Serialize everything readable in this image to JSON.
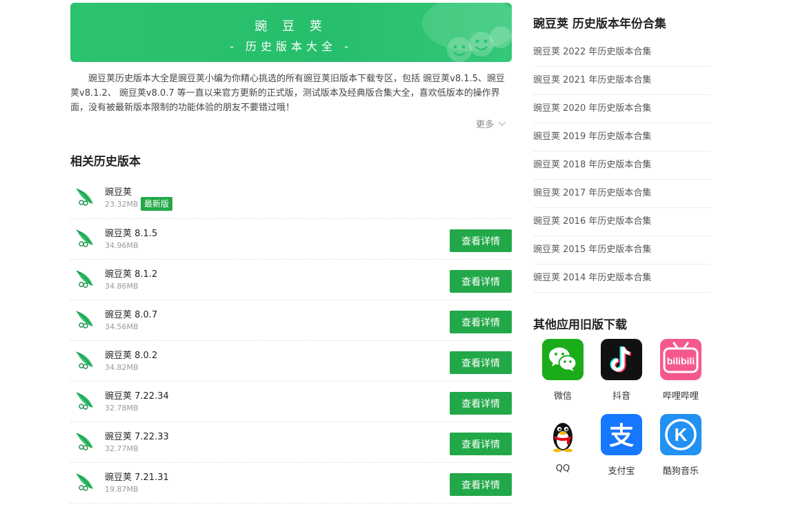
{
  "banner": {
    "title": "豌 豆 荚",
    "subtitle": "- 历史版本大全 -"
  },
  "intro": "豌豆荚历史版本大全是豌豆荚小编为你精心挑选的所有豌豆荚旧版本下载专区，包括 豌豆荚v8.1.5、豌豆荚v8.1.2、 豌豆荚v8.0.7 等一直以来官方更新的正式版，测试版本及经典版合集大全，喜欢低版本的操作界面，没有被最新版本限制的功能体验的朋友不要错过哦！",
  "more_label": "更多",
  "versions_title": "相关历史版本",
  "versions": [
    {
      "name": "豌豆荚",
      "size": "23.32MB",
      "badge": "最新版"
    },
    {
      "name": "豌豆荚 8.1.5",
      "size": "34.96MB",
      "button": "查看详情"
    },
    {
      "name": "豌豆荚 8.1.2",
      "size": "34.86MB",
      "button": "查看详情"
    },
    {
      "name": "豌豆荚 8.0.7",
      "size": "34.56MB",
      "button": "查看详情"
    },
    {
      "name": "豌豆荚 8.0.2",
      "size": "34.82MB",
      "button": "查看详情"
    },
    {
      "name": "豌豆荚 7.22.34",
      "size": "32.78MB",
      "button": "查看详情"
    },
    {
      "name": "豌豆荚 7.22.33",
      "size": "32.77MB",
      "button": "查看详情"
    },
    {
      "name": "豌豆荚 7.21.31",
      "size": "19.87MB",
      "button": "查看详情"
    }
  ],
  "years_title": "豌豆荚 历史版本年份合集",
  "years": [
    "豌豆荚 2022 年历史版本合集",
    "豌豆荚 2021 年历史版本合集",
    "豌豆荚 2020 年历史版本合集",
    "豌豆荚 2019 年历史版本合集",
    "豌豆荚 2018 年历史版本合集",
    "豌豆荚 2017 年历史版本合集",
    "豌豆荚 2016 年历史版本合集",
    "豌豆荚 2015 年历史版本合集",
    "豌豆荚 2014 年历史版本合集"
  ],
  "other_title": "其他应用旧版下载",
  "other_apps": [
    {
      "name": "微信",
      "icon": "wechat-icon",
      "color": "#1aad19"
    },
    {
      "name": "抖音",
      "icon": "douyin-icon",
      "color": "#111111"
    },
    {
      "name": "哔哩哔哩",
      "icon": "bilibili-icon",
      "color": "#f5588f"
    },
    {
      "name": "QQ",
      "icon": "qq-icon",
      "color": "#ffffff"
    },
    {
      "name": "支付宝",
      "icon": "alipay-icon",
      "color": "#1677ff"
    },
    {
      "name": "酷狗音乐",
      "icon": "kugou-icon",
      "color": "#2291f4"
    }
  ],
  "colors": {
    "brand_green": "#22a848",
    "banner_green": "#2cc36f"
  }
}
